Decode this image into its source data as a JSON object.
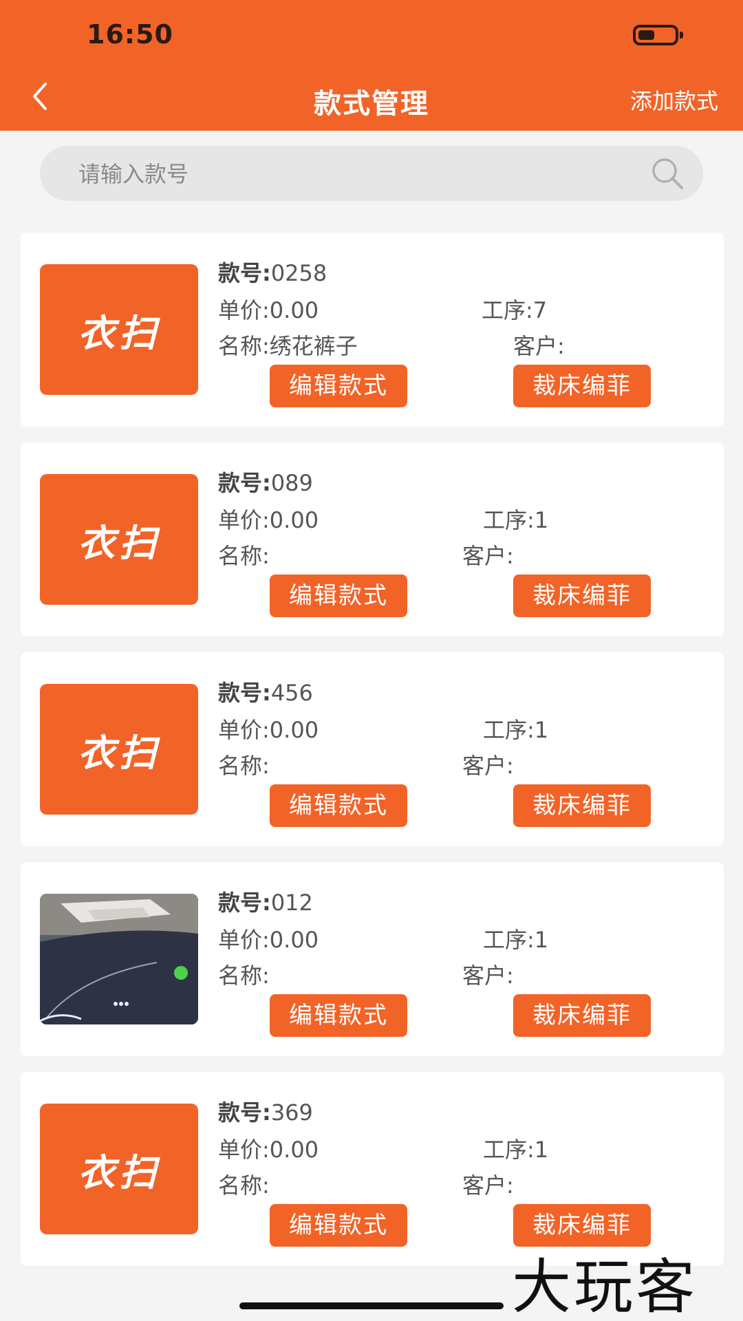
{
  "status_bar": {
    "time": "16:50",
    "battery_level": 0.45
  },
  "header": {
    "title": "款式管理",
    "add_label": "添加款式",
    "back_icon": "chevron-left-icon"
  },
  "search": {
    "placeholder": "请输入款号",
    "value": "",
    "icon": "search-icon"
  },
  "labels": {
    "code": "款号:",
    "price": "单价:",
    "process": "工序:",
    "name": "名称:",
    "customer": "客户:",
    "edit": "编辑款式",
    "cut": "裁床编菲"
  },
  "logo_text": "衣扫",
  "items": [
    {
      "code": "0258",
      "price": "0.00",
      "process": "7",
      "name": "绣花裤子",
      "customer": "",
      "image": "logo"
    },
    {
      "code": "089",
      "price": "0.00",
      "process": "1",
      "name": "",
      "customer": "",
      "image": "logo"
    },
    {
      "code": "456",
      "price": "0.00",
      "process": "1",
      "name": "",
      "customer": "",
      "image": "logo"
    },
    {
      "code": "012",
      "price": "0.00",
      "process": "1",
      "name": "",
      "customer": "",
      "image": "photo"
    },
    {
      "code": "369",
      "price": "0.00",
      "process": "1",
      "name": "",
      "customer": "",
      "image": "logo"
    }
  ],
  "watermark": "大玩客",
  "colors": {
    "accent": "#f26328",
    "background": "#f4f4f4",
    "card": "#ffffff"
  }
}
